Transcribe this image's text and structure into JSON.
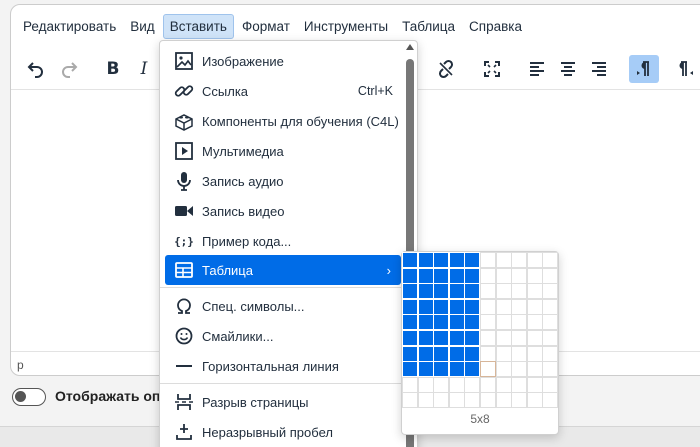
{
  "menubar": {
    "items": [
      "Редактировать",
      "Вид",
      "Вставить",
      "Формат",
      "Инструменты",
      "Таблица",
      "Справка"
    ],
    "active_index": 2
  },
  "toolbar": {
    "bold_label": "B",
    "italic_label": "I",
    "buttons": [
      "undo-icon",
      "redo-icon",
      "bold",
      "italic",
      "unlink-icon",
      "fullscreen-icon",
      "align-left-icon",
      "align-center-icon",
      "align-right-icon",
      "ltr-icon",
      "rtl-icon"
    ]
  },
  "statusbar": {
    "path": "p"
  },
  "description_toggle": {
    "label": "Отображать опи",
    "on": false
  },
  "insert_menu": {
    "items": [
      {
        "label": "Изображение",
        "icon": "image-icon"
      },
      {
        "label": "Ссылка",
        "icon": "link-icon",
        "shortcut": "Ctrl+K"
      },
      {
        "label": "Компоненты для обучения (C4L)",
        "icon": "lego-brick-icon"
      },
      {
        "label": "Мультимедиа",
        "icon": "media-play-icon"
      },
      {
        "label": "Запись аудио",
        "icon": "microphone-icon"
      },
      {
        "label": "Запись видео",
        "icon": "video-camera-icon"
      },
      {
        "label": "Пример кода...",
        "icon": "code-sample-icon"
      },
      {
        "label": "Таблица",
        "icon": "table-icon",
        "submenu": true,
        "highlighted": true
      },
      {
        "label": "Спец. символы...",
        "icon": "omega-icon"
      },
      {
        "label": "Смайлики...",
        "icon": "smiley-icon"
      },
      {
        "label": "Горизонтальная линия",
        "icon": "horizontal-line-icon"
      },
      {
        "label": "Разрыв страницы",
        "icon": "page-break-icon"
      },
      {
        "label": "Неразрывный пробел",
        "icon": "nbsp-icon"
      }
    ],
    "chevron": "›"
  },
  "table_picker": {
    "size_label": "5x8",
    "selected_cols": 5,
    "selected_rows": 8,
    "grid_cols": 10,
    "grid_rows": 10,
    "accent_color": "#006ce7"
  },
  "colors": {
    "accent": "#006ce7",
    "menu_active_bg": "#cfe3f8",
    "pressed_button_bg": "#a6ccf7"
  }
}
